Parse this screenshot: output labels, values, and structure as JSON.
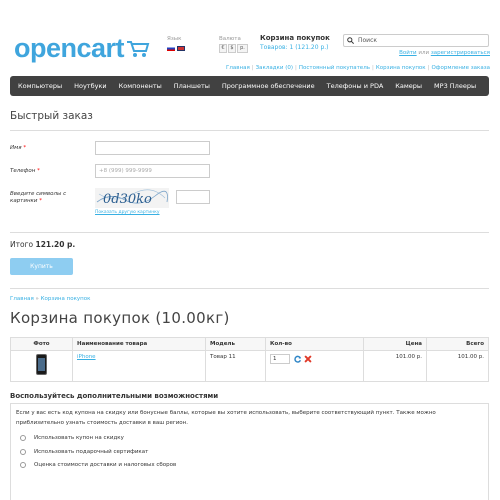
{
  "header": {
    "logo_text": "opencart",
    "language_label": "Язык",
    "currency_label": "Валюта",
    "currencies": [
      "€",
      "$",
      "р."
    ],
    "cart_title": "Корзина покупок",
    "cart_summary": "Товаров: 1 (121.20 р.)",
    "search_placeholder": "Поиск",
    "welcome_prefix": "Войти",
    "welcome_mid": "или",
    "welcome_register": "зарегистрироваться",
    "top_links": [
      "Главная",
      "Закладки (0)",
      "Постоянный покупатель",
      "Корзина покупок",
      "Оформление заказа"
    ]
  },
  "menu": [
    "Компьютеры",
    "Ноутбуки",
    "Компоненты",
    "Планшеты",
    "Программное обеспечение",
    "Телефоны и PDA",
    "Камеры",
    "MP3 Плееры"
  ],
  "quick_order": {
    "title": "Быстрый заказ",
    "name_label": "Имя",
    "phone_label": "Телефон",
    "phone_placeholder": "+8 (999) 999-9999",
    "captcha_label": "Введите символы с картинки",
    "captcha_text": "0d30ko",
    "refresh_link": "Показать другую картинку",
    "total_label": "Итого",
    "total_value": "121.20 р.",
    "buy_button": "Купить"
  },
  "breadcrumb": [
    "Главная",
    "Корзина покупок"
  ],
  "cart": {
    "title": "Корзина покупок  (10.00кг)",
    "columns": [
      "Фото",
      "Наименование товара",
      "Модель",
      "Кол-во",
      "Цена",
      "Всего"
    ],
    "items": [
      {
        "name": "iPhone",
        "model": "Товар 11",
        "qty": "1",
        "price": "101.00 р.",
        "total": "101.00 р."
      }
    ]
  },
  "options": {
    "title": "Воспользуйтесь дополнительными возможностями",
    "description": "Если у вас есть код купона на скидку или бонусные баллы, которые вы хотите использовать, выберите соответствующий пункт. Также можно приблизительно узнать стоимость доставки в ваш регион.",
    "choices": [
      "Использовать купон на скидку",
      "Использовать подарочный сертификат",
      "Оценка стоимости доставки и налоговых сборов"
    ]
  },
  "colors": {
    "accent": "#38b0e3",
    "menu_bg": "#414141",
    "button": "#8ecdf1"
  }
}
